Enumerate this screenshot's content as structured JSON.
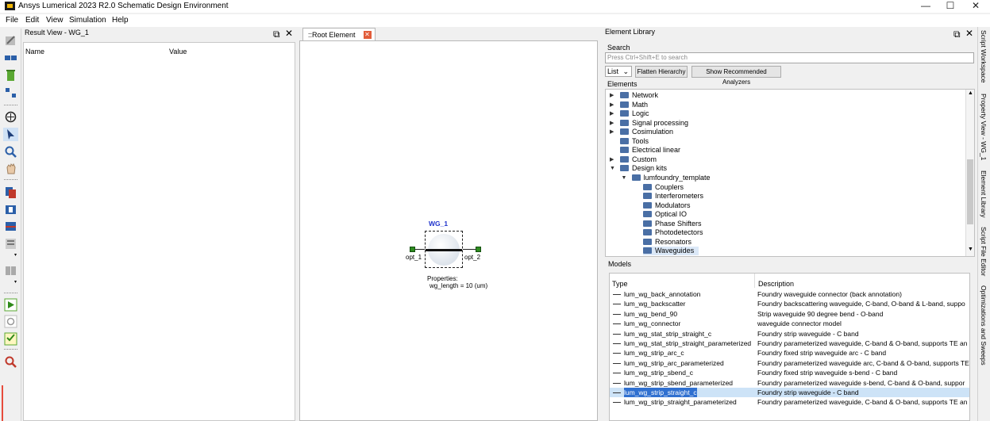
{
  "window": {
    "title": "Ansys Lumerical 2023 R2.0 Schematic Design Environment",
    "minimize": "—",
    "maximize": "☐",
    "close": "✕"
  },
  "menu": [
    "File",
    "Edit",
    "View",
    "Simulation",
    "Help"
  ],
  "result_view": {
    "title": "Result View - WG_1",
    "col_name": "Name",
    "col_value": "Value"
  },
  "schematic": {
    "tab": "::Root Element",
    "element": {
      "name": "WG_1",
      "port_left": "opt_1",
      "port_right": "opt_2",
      "properties_label": "Properties:",
      "property": "wg_length = 10 (um)"
    }
  },
  "library": {
    "title": "Element Library",
    "search_label": "Search",
    "search_placeholder": "Press Ctrl+Shift+E to search",
    "view_mode": "List",
    "flatten_btn": "Flatten Hierarchy",
    "recommend_btn": "Show Recommended Analyzers",
    "elements_label": "Elements",
    "tree": [
      {
        "label": "Network",
        "depth": 0,
        "arrow": "▶"
      },
      {
        "label": "Math",
        "depth": 0,
        "arrow": "▶"
      },
      {
        "label": "Logic",
        "depth": 0,
        "arrow": "▶"
      },
      {
        "label": "Signal processing",
        "depth": 0,
        "arrow": "▶"
      },
      {
        "label": "Cosimulation",
        "depth": 0,
        "arrow": "▶"
      },
      {
        "label": "Tools",
        "depth": 0,
        "arrow": ""
      },
      {
        "label": "Electrical linear",
        "depth": 0,
        "arrow": ""
      },
      {
        "label": "Custom",
        "depth": 0,
        "arrow": "▶"
      },
      {
        "label": "Design kits",
        "depth": 0,
        "arrow": "▼"
      },
      {
        "label": "lumfoundry_template",
        "depth": 1,
        "arrow": "▼"
      },
      {
        "label": "Couplers",
        "depth": 2,
        "arrow": ""
      },
      {
        "label": "Interferometers",
        "depth": 2,
        "arrow": ""
      },
      {
        "label": "Modulators",
        "depth": 2,
        "arrow": ""
      },
      {
        "label": "Optical IO",
        "depth": 2,
        "arrow": ""
      },
      {
        "label": "Phase Shifters",
        "depth": 2,
        "arrow": ""
      },
      {
        "label": "Photodetectors",
        "depth": 2,
        "arrow": ""
      },
      {
        "label": "Resonators",
        "depth": 2,
        "arrow": ""
      },
      {
        "label": "Waveguides",
        "depth": 2,
        "arrow": "",
        "selected": true
      }
    ],
    "models_label": "Models",
    "col_type": "Type",
    "col_desc": "Description",
    "models": [
      {
        "type": "lum_wg_back_annotation",
        "desc": "Foundry waveguide connector (back annotation)"
      },
      {
        "type": "lum_wg_backscatter",
        "desc": "Foundry backscattering waveguide, C-band, O-band & L-band, suppo"
      },
      {
        "type": "lum_wg_bend_90",
        "desc": "Strip waveguide 90 degree bend - O-band"
      },
      {
        "type": "lum_wg_connector",
        "desc": "waveguide connector model"
      },
      {
        "type": "lum_wg_stat_strip_straight_c",
        "desc": "Foundry strip waveguide - C band"
      },
      {
        "type": "lum_wg_stat_strip_straight_parameterized",
        "desc": "Foundry parameterized waveguide, C-band & O-band, supports TE an"
      },
      {
        "type": "lum_wg_strip_arc_c",
        "desc": "Foundry fixed strip waveguide arc - C band"
      },
      {
        "type": "lum_wg_strip_arc_parameterized",
        "desc": "Foundry parameterized waveguide arc, C-band & O-band, supports TE"
      },
      {
        "type": "lum_wg_strip_sbend_c",
        "desc": "Foundry fixed strip waveguide s-bend - C band"
      },
      {
        "type": "lum_wg_strip_sbend_parameterized",
        "desc": "Foundry parameterized waveguide s-bend, C-band & O-band, suppor"
      },
      {
        "type": "lum_wg_strip_straight_c",
        "desc": "Foundry strip waveguide - C band",
        "selected": true
      },
      {
        "type": "lum_wg_strip_straight_parameterized",
        "desc": "Foundry parameterized waveguide, C-band & O-band, supports TE an"
      }
    ]
  },
  "side_tabs": [
    "Script Workspace",
    "Property View - WG_1",
    "Element Library",
    "Script File Editor",
    "Optimizations and Sweeps"
  ]
}
